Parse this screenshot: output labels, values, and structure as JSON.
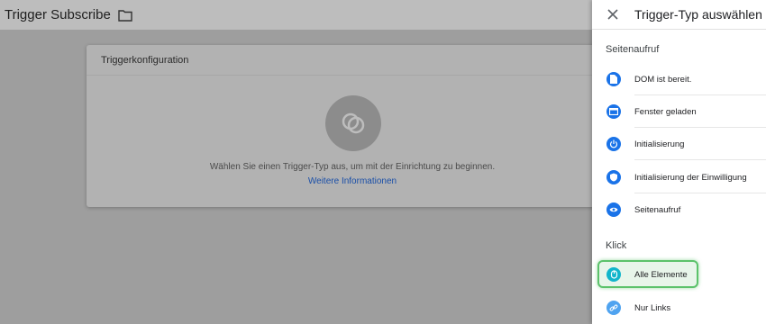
{
  "page": {
    "title": "Trigger Subscribe",
    "folder_icon": "folder-icon"
  },
  "card": {
    "header": "Triggerkonfiguration",
    "message": "Wählen Sie einen Trigger-Typ aus, um mit der Einrichtung zu beginnen.",
    "link": "Weitere Informationen",
    "icon": "trigger-placeholder-icon"
  },
  "panel": {
    "title": "Trigger-Typ auswählen",
    "close_icon": "close-icon",
    "sections": [
      {
        "label": "Seitenaufruf",
        "items": [
          {
            "label": "DOM ist bereit.",
            "icon": "document-icon"
          },
          {
            "label": "Fenster geladen",
            "icon": "window-icon"
          },
          {
            "label": "Initialisierung",
            "icon": "power-icon"
          },
          {
            "label": "Initialisierung der Einwilligung",
            "icon": "shield-icon"
          },
          {
            "label": "Seitenaufruf",
            "icon": "eye-icon"
          }
        ]
      },
      {
        "label": "Klick",
        "items": [
          {
            "label": "Alle Elemente",
            "icon": "pointer-icon",
            "highlighted": true
          },
          {
            "label": "Nur Links",
            "icon": "link-icon"
          }
        ]
      }
    ]
  },
  "colors": {
    "accent": "#1a73e8",
    "highlight_border": "#5cc26b",
    "overlay": "#9e9e9e"
  }
}
